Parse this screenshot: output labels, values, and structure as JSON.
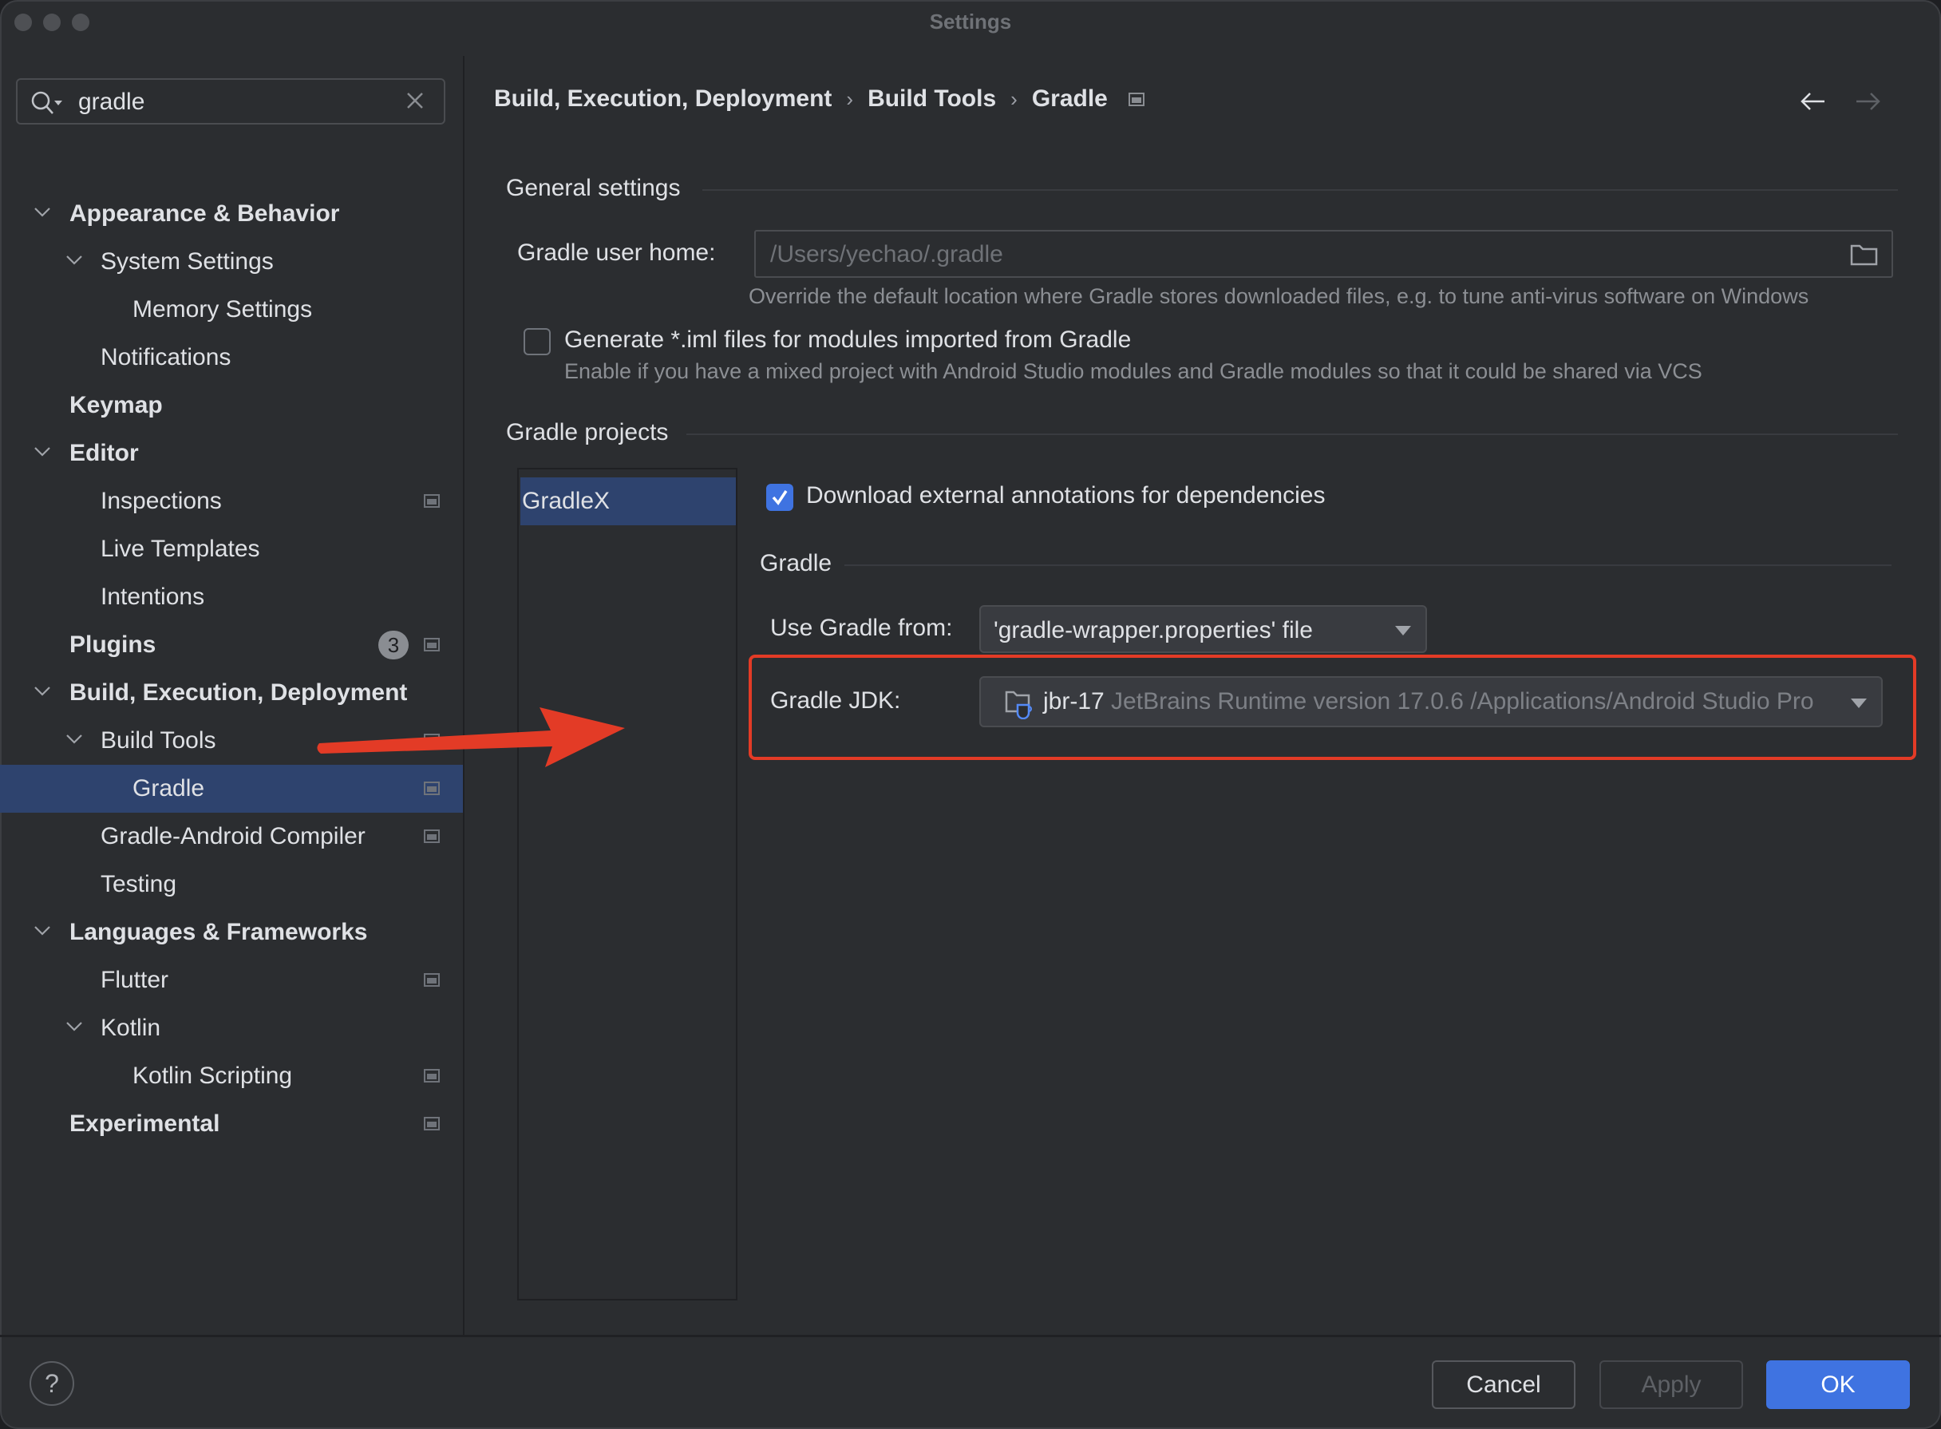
{
  "window": {
    "title": "Settings"
  },
  "search": {
    "value": "gradle",
    "icon": "search-icon",
    "clear_icon": "close-icon"
  },
  "tree": [
    {
      "label": "Appearance & Behavior",
      "level": 0,
      "bold": true,
      "expanded": true
    },
    {
      "label": "System Settings",
      "level": 1,
      "bold": false,
      "expanded": true
    },
    {
      "label": "Memory Settings",
      "level": 2,
      "bold": false
    },
    {
      "label": "Notifications",
      "level": 1,
      "bold": false
    },
    {
      "label": "Keymap",
      "level": 0,
      "bold": true
    },
    {
      "label": "Editor",
      "level": 0,
      "bold": true,
      "expanded": true
    },
    {
      "label": "Inspections",
      "level": 1,
      "bold": false,
      "project_icon": true
    },
    {
      "label": "Live Templates",
      "level": 1,
      "bold": false
    },
    {
      "label": "Intentions",
      "level": 1,
      "bold": false
    },
    {
      "label": "Plugins",
      "level": 0,
      "bold": true,
      "badge": "3",
      "project_icon": true
    },
    {
      "label": "Build, Execution, Deployment",
      "level": 0,
      "bold": true,
      "expanded": true
    },
    {
      "label": "Build Tools",
      "level": 1,
      "bold": false,
      "expanded": true,
      "project_icon": true
    },
    {
      "label": "Gradle",
      "level": 2,
      "bold": false,
      "selected": true,
      "project_icon": true
    },
    {
      "label": "Gradle-Android Compiler",
      "level": 1,
      "bold": false,
      "project_icon": true
    },
    {
      "label": "Testing",
      "level": 1,
      "bold": false
    },
    {
      "label": "Languages & Frameworks",
      "level": 0,
      "bold": true,
      "expanded": true
    },
    {
      "label": "Flutter",
      "level": 1,
      "bold": false,
      "project_icon": true
    },
    {
      "label": "Kotlin",
      "level": 1,
      "bold": false,
      "expanded": true
    },
    {
      "label": "Kotlin Scripting",
      "level": 2,
      "bold": false,
      "project_icon": true
    },
    {
      "label": "Experimental",
      "level": 0,
      "bold": true,
      "project_icon": true
    }
  ],
  "breadcrumb": {
    "items": [
      "Build, Execution, Deployment",
      "Build Tools",
      "Gradle"
    ],
    "separator": "›"
  },
  "nav": {
    "back": "←",
    "forward": "→"
  },
  "general": {
    "title": "General settings",
    "user_home_label": "Gradle user home:",
    "user_home_value": "/Users/yechao/.gradle",
    "user_home_hint": "Override the default location where Gradle stores downloaded files, e.g. to tune anti-virus software on Windows",
    "iml_label": "Generate *.iml files for modules imported from Gradle",
    "iml_checked": false,
    "iml_hint": "Enable if you have a mixed project with Android Studio modules and Gradle modules so that it could be shared via VCS"
  },
  "projects": {
    "title": "Gradle projects",
    "list": [
      "GradleX"
    ],
    "download_annotations_label": "Download external annotations for dependencies",
    "download_annotations_checked": true,
    "gradle_section_title": "Gradle",
    "use_gradle_from_label": "Use Gradle from:",
    "use_gradle_from_value": "'gradle-wrapper.properties' file",
    "jdk_label": "Gradle JDK:",
    "jdk_name": "jbr-17",
    "jdk_detail": "JetBrains Runtime version 17.0.6 /Applications/Android Studio Pro"
  },
  "footer": {
    "help": "?",
    "cancel": "Cancel",
    "apply": "Apply",
    "ok": "OK"
  },
  "colors": {
    "accent": "#3f73e1",
    "selection": "#2e436e",
    "annotation": "#e33b26",
    "background": "#2b2d30"
  }
}
